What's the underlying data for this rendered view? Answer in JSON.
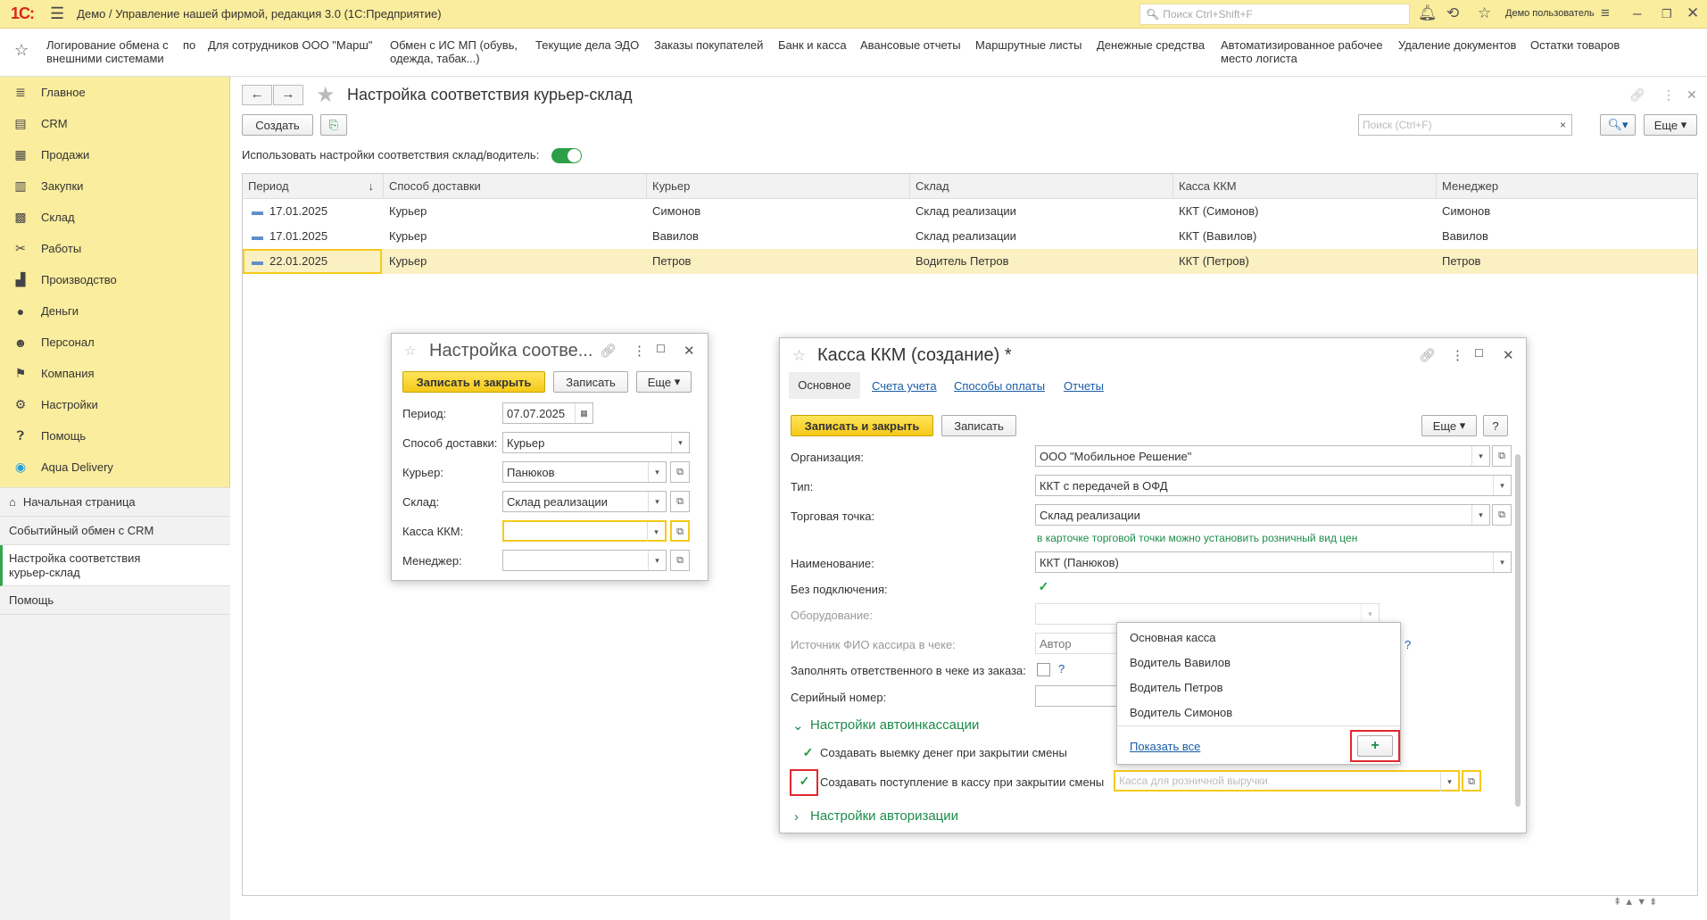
{
  "topbar": {
    "logo": "1С:",
    "title": "Демо / Управление нашей фирмой, редакция 3.0  (1С:Предприятие)",
    "search_placeholder": "Поиск Ctrl+Shift+F",
    "user": "Демо пользователь"
  },
  "favorites": [
    "Логирование обмена с внешними системами",
    "по",
    "Для сотрудников ООО \"Марш\"",
    "Обмен с ИС МП (обувь, одежда, табак...)",
    "Текущие дела ЭДО",
    "Заказы покупателей",
    "Банк и касса",
    "Авансовые отчеты",
    "Маршрутные листы",
    "Денежные средства",
    "Автоматизированное рабочее место логиста",
    "Удаление документов",
    "Остатки товаров"
  ],
  "sidebar": {
    "items": [
      "Главное",
      "CRM",
      "Продажи",
      "Закупки",
      "Склад",
      "Работы",
      "Производство",
      "Деньги",
      "Персонал",
      "Компания",
      "Настройки",
      "Помощь",
      "Aqua Delivery"
    ],
    "open": [
      "Начальная страница",
      "Событийный обмен с CRM",
      "Настройка соответствия курьер-склад",
      "Помощь"
    ]
  },
  "page": {
    "title": "Настройка соответствия курьер-склад",
    "create": "Создать",
    "search_placeholder": "Поиск (Ctrl+F)",
    "more": "Еще",
    "toggle_label": "Использовать настройки соответствия склад/водитель:"
  },
  "table": {
    "columns": [
      "Период",
      "Способ доставки",
      "Курьер",
      "Склад",
      "Касса ККМ",
      "Менеджер"
    ],
    "rows": [
      [
        "17.01.2025",
        "Курьер",
        "Симонов",
        "Склад реализации",
        "ККТ (Симонов)",
        "Симонов"
      ],
      [
        "17.01.2025",
        "Курьер",
        "Вавилов",
        "Склад реализации",
        "ККТ (Вавилов)",
        "Вавилов"
      ],
      [
        "22.01.2025",
        "Курьер",
        "Петров",
        "Водитель Петров",
        "ККТ (Петров)",
        "Петров"
      ]
    ]
  },
  "dialog1": {
    "title": "Настройка соотве...",
    "save_close": "Записать и закрыть",
    "save": "Записать",
    "more": "Еще",
    "period_label": "Период:",
    "period": "07.07.2025",
    "delivery_label": "Способ доставки:",
    "delivery": "Курьер",
    "courier_label": "Курьер:",
    "courier": "Панюков",
    "warehouse_label": "Склад:",
    "warehouse": "Склад реализации",
    "kkm_label": "Касса ККМ:",
    "manager_label": "Менеджер:"
  },
  "dialog2": {
    "title": "Касса ККМ (создание) *",
    "tabs": [
      "Основное",
      "Счета учета",
      "Способы оплаты",
      "Отчеты"
    ],
    "save_close": "Записать и закрыть",
    "save": "Записать",
    "more": "Еще",
    "help": "?",
    "org_label": "Организация:",
    "org": "ООО \"Мобильное Решение\"",
    "type_label": "Тип:",
    "type": "ККТ с передачей в ОФД",
    "point_label": "Торговая точка:",
    "point": "Склад реализации",
    "point_hint": "в карточке торговой точки можно установить розничный вид цен",
    "name_label": "Наименование:",
    "name": "ККТ (Панюков)",
    "offline_label": "Без подключения:",
    "equip_label": "Оборудование:",
    "cashier_label": "Источник ФИО кассира в чеке:",
    "cashier": "Автор",
    "fill_label": "Заполнять ответственного в чеке из заказа:",
    "serial_label": "Серийный номер:",
    "auto_section": "Настройки автоинкассации",
    "auto_chk1": "Создавать выемку денег при закрытии смены",
    "auto_chk2": "Создавать поступление в кассу при закрытии смены",
    "retail_placeholder": "Касса для розничной выручки",
    "auth_section": "Настройки авторизации"
  },
  "popup": {
    "items": [
      "Основная касса",
      "Водитель Вавилов",
      "Водитель Петров",
      "Водитель Симонов"
    ],
    "show_all": "Показать все",
    "add": "+"
  }
}
